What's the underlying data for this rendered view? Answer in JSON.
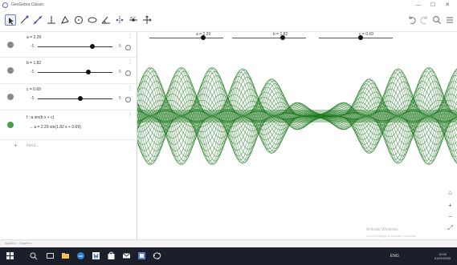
{
  "window": {
    "title": "GeoGebra Classic",
    "controls": {
      "minimize": "—",
      "maximize": "☐",
      "close": "✕"
    }
  },
  "toolbar": {
    "tools": [
      {
        "name": "move-tool",
        "active": true
      },
      {
        "name": "point-tool"
      },
      {
        "name": "line-tool"
      },
      {
        "name": "perpendicular-tool"
      },
      {
        "name": "polygon-tool"
      },
      {
        "name": "circle-tool"
      },
      {
        "name": "conic-tool"
      },
      {
        "name": "angle-tool"
      },
      {
        "name": "reflect-tool"
      },
      {
        "name": "slider-tool"
      },
      {
        "name": "move-graphics-tool"
      }
    ],
    "right": [
      "undo-icon",
      "redo-icon",
      "search-icon",
      "menu-icon"
    ]
  },
  "algebra": {
    "rows": [
      {
        "def": "a = 2.29",
        "min": "-5",
        "max": "5",
        "knob": 0.729
      },
      {
        "def": "b = 1.82",
        "min": "-5",
        "max": "5",
        "knob": 0.682
      },
      {
        "def": "c = 0.69",
        "min": "-5",
        "max": "5",
        "knob": 0.569
      }
    ],
    "function": {
      "def": "f : a sin(b x + c)",
      "value": "→  a = 2.29 sin(1.82 x + 0.69)"
    },
    "input_placeholder": "Input..."
  },
  "graphics": {
    "sliders": [
      {
        "label": "a = 2.29",
        "knob": 0.729
      },
      {
        "label": "b = 1.82",
        "knob": 0.682
      },
      {
        "label": "c = 0.69",
        "knob": 0.569
      }
    ],
    "curve_color": "#1f7a1f",
    "watermark_line1": "Activate Windows",
    "watermark_line2": "Go to Settings to activate Windows."
  },
  "statusbar": {
    "text": "Algebra · Graphics"
  },
  "taskbar": {
    "icons": [
      "windows-start-icon",
      "search-icon",
      "task-view-icon",
      "file-explorer-icon",
      "edge-icon",
      "word-icon",
      "store-icon",
      "mail-icon",
      "photos-icon",
      "geogebra-icon"
    ],
    "system_tray": "ENG",
    "time": "12:00",
    "date": "01/01/2020"
  },
  "colors": {
    "accent": "#6c7fcf",
    "marble_grey": "#8a8a8a",
    "marble_green": "#4c9a4c",
    "taskbar": "#1b1f2a"
  }
}
